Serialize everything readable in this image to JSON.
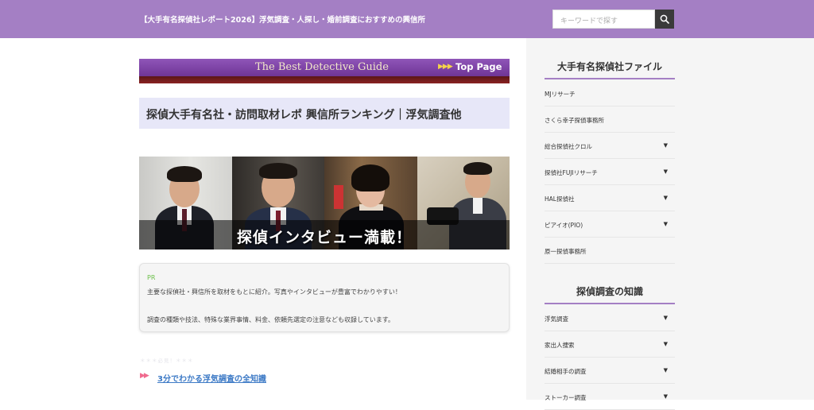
{
  "header": {
    "site_title": "【大手有名探偵社レポート2026】浮気調査・人探し・婚前調査におすすめの興信所",
    "search_placeholder": "キーワードで探す",
    "search_icon": "search-icon",
    "bar_color": "#a47fc4"
  },
  "banner": {
    "title": "The Best Detective Guide",
    "arrows": "▶▶▶",
    "link": "Top Page"
  },
  "main": {
    "page_title": "探偵大手有名社・訪問取材レポ 興信所ランキング｜浮気調査他",
    "hero_caption": "探偵インタビュー満載！",
    "pr": {
      "label": "PR",
      "line1": "主要な探偵社・興信所を取材をもとに紹介。写真やインタビューが豊富でわかりやすい！",
      "line2": "調査の種類や技法、特殊な業界事情、料金、依頼先選定の注意なども収録しています。"
    },
    "faded_text": "＊＊＊必見！＊＊＊",
    "link_arrows": "▶▶",
    "link_text": "3分でわかる浮気調査の全知識"
  },
  "sidebar": {
    "widget1_title": "大手有名探偵社ファイル",
    "widget1_items": [
      {
        "label": "MJリサーチ",
        "caret": ""
      },
      {
        "label": "さくら幸子探偵事務所",
        "caret": ""
      },
      {
        "label": "総合探偵社クロル",
        "caret": "▼"
      },
      {
        "label": "探偵社FUJIリサーチ",
        "caret": "▼"
      },
      {
        "label": "HAL探偵社",
        "caret": "▼"
      },
      {
        "label": "ピアイオ(PIO)",
        "caret": "▼"
      },
      {
        "label": "原一探偵事務所",
        "caret": ""
      }
    ],
    "widget2_title": "探偵調査の知識",
    "widget2_items": [
      {
        "label": "浮気調査",
        "caret": "▼"
      },
      {
        "label": "家出人捜索",
        "caret": "▼"
      },
      {
        "label": "結婚相手の調査",
        "caret": "▼"
      },
      {
        "label": "ストーカー調査",
        "caret": "▼"
      }
    ]
  }
}
